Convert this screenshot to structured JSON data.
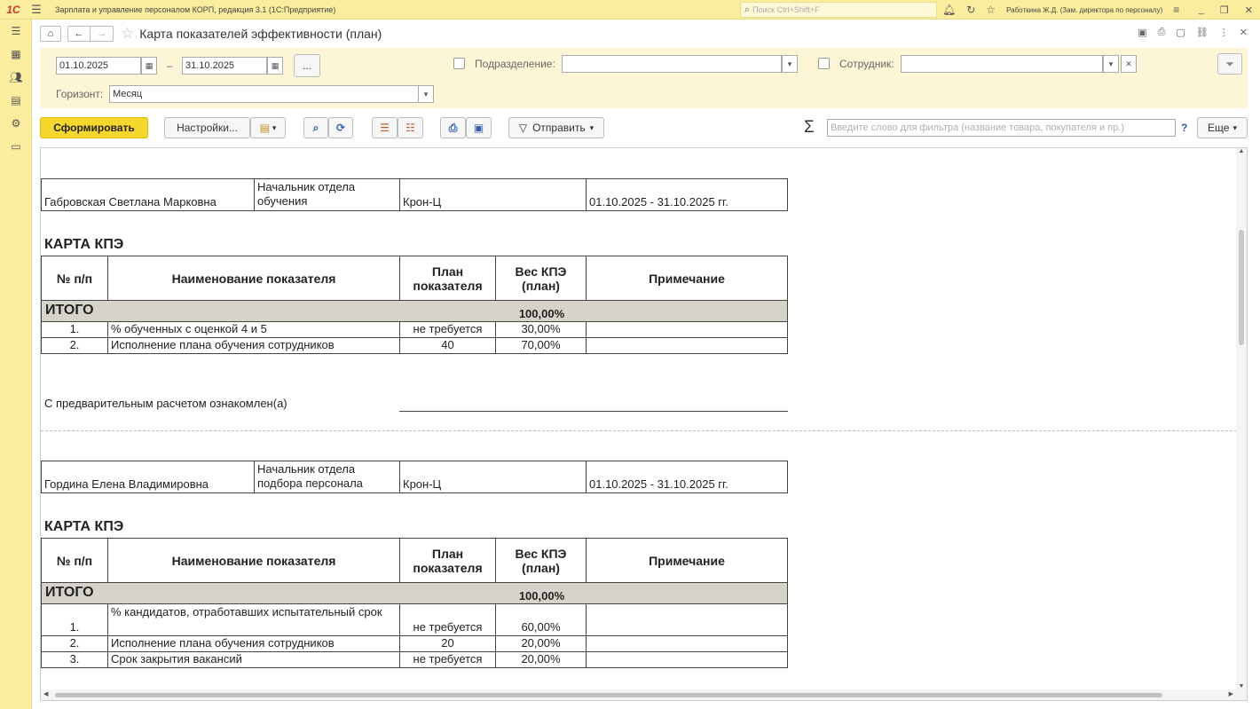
{
  "app": {
    "logo": "1С",
    "title": "Зарплата и управление персоналом КОРП, редакция 3.1  (1С:Предприятие)",
    "search_placeholder": "Поиск Ctrl+Shift+F",
    "user": "Работкина Ж.Д. (Зам. директора по персоналу)"
  },
  "form": {
    "title": "Карта показателей эффективности (план)"
  },
  "filters": {
    "date_from": "01.10.2025",
    "date_sep": "–",
    "date_to": "31.10.2025",
    "period_button": "...",
    "department_label": "Подразделение:",
    "department_value": "",
    "employee_label": "Сотрудник:",
    "employee_value": "",
    "horizon_label": "Горизонт:",
    "horizon_value": "Месяц"
  },
  "toolbar": {
    "generate": "Сформировать",
    "settings": "Настройки...",
    "send": "Отправить",
    "filter_placeholder": "Введите слово для фильтра (название товара, покупателя и пр.)",
    "help": "?",
    "more": "Еще"
  },
  "report": {
    "cards": [
      {
        "employee": "Габровская Светлана Марковна",
        "position": "Начальник отдела обучения",
        "organization": "Крон-Ц",
        "period": "01.10.2025 - 31.10.2025 гг.",
        "section_title": "КАРТА КПЭ",
        "headers": {
          "num": "№ п/п",
          "name": "Наименование показателя",
          "plan": "План показателя",
          "weight": "Вес КПЭ (план)",
          "note": "Примечание"
        },
        "total_label": "ИТОГО",
        "total_weight": "100,00%",
        "rows": [
          {
            "num": "1.",
            "name": "% обученных с оценкой 4 и 5",
            "plan": "не требуется",
            "weight": "30,00%",
            "note": ""
          },
          {
            "num": "2.",
            "name": "Исполнение плана обучения сотрудников",
            "plan": "40",
            "weight": "70,00%",
            "note": ""
          }
        ],
        "acknowledged": "С предварительным расчетом ознакомлен(а)"
      },
      {
        "employee": "Гордина Елена Владимировна",
        "position": "Начальник отдела подбора персонала",
        "organization": "Крон-Ц",
        "period": "01.10.2025 - 31.10.2025 гг.",
        "section_title": "КАРТА КПЭ",
        "headers": {
          "num": "№ п/п",
          "name": "Наименование показателя",
          "plan": "План показателя",
          "weight": "Вес КПЭ (план)",
          "note": "Примечание"
        },
        "total_label": "ИТОГО",
        "total_weight": "100,00%",
        "rows": [
          {
            "num": "1.",
            "name": "% кандидатов, отработавших испытательный срок",
            "plan": "не требуется",
            "weight": "60,00%",
            "note": ""
          },
          {
            "num": "2.",
            "name": "Исполнение плана обучения сотрудников",
            "plan": "20",
            "weight": "20,00%",
            "note": ""
          },
          {
            "num": "3.",
            "name": "Срок закрытия вакансий",
            "plan": "не требуется",
            "weight": "20,00%",
            "note": ""
          }
        ]
      }
    ]
  }
}
